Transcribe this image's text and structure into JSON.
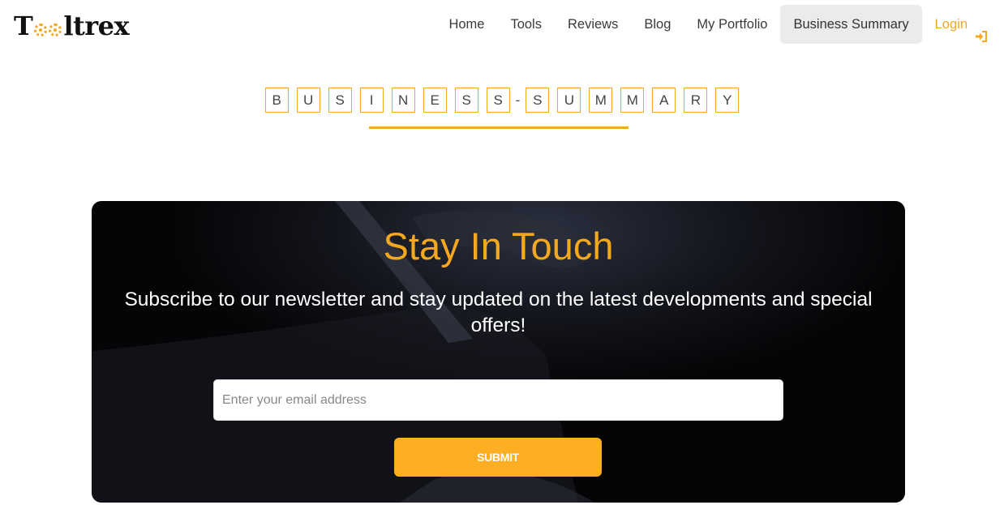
{
  "brand": {
    "name_prefix": "T",
    "name_suffix": "ltrex",
    "accent_color": "#f4a81f"
  },
  "nav": {
    "items": [
      {
        "label": "Home",
        "active": false
      },
      {
        "label": "Tools",
        "active": false
      },
      {
        "label": "Reviews",
        "active": false
      },
      {
        "label": "Blog",
        "active": false
      },
      {
        "label": "My Portfolio",
        "active": false
      },
      {
        "label": "Business Summary",
        "active": true
      }
    ],
    "login": {
      "label": "Login",
      "icon": "sign-in-icon"
    }
  },
  "section_title": {
    "letters": [
      "B",
      "U",
      "S",
      "I",
      "N",
      "E",
      "S",
      "S",
      "-",
      "S",
      "U",
      "M",
      "M",
      "A",
      "R",
      "Y"
    ]
  },
  "newsletter": {
    "title": "Stay In Touch",
    "subtitle": "Subscribe to our newsletter and stay updated on the latest developments and special offers!",
    "email_placeholder": "Enter your email address",
    "email_value": "",
    "submit_label": "SUBMIT",
    "button_color": "#fdae23"
  }
}
